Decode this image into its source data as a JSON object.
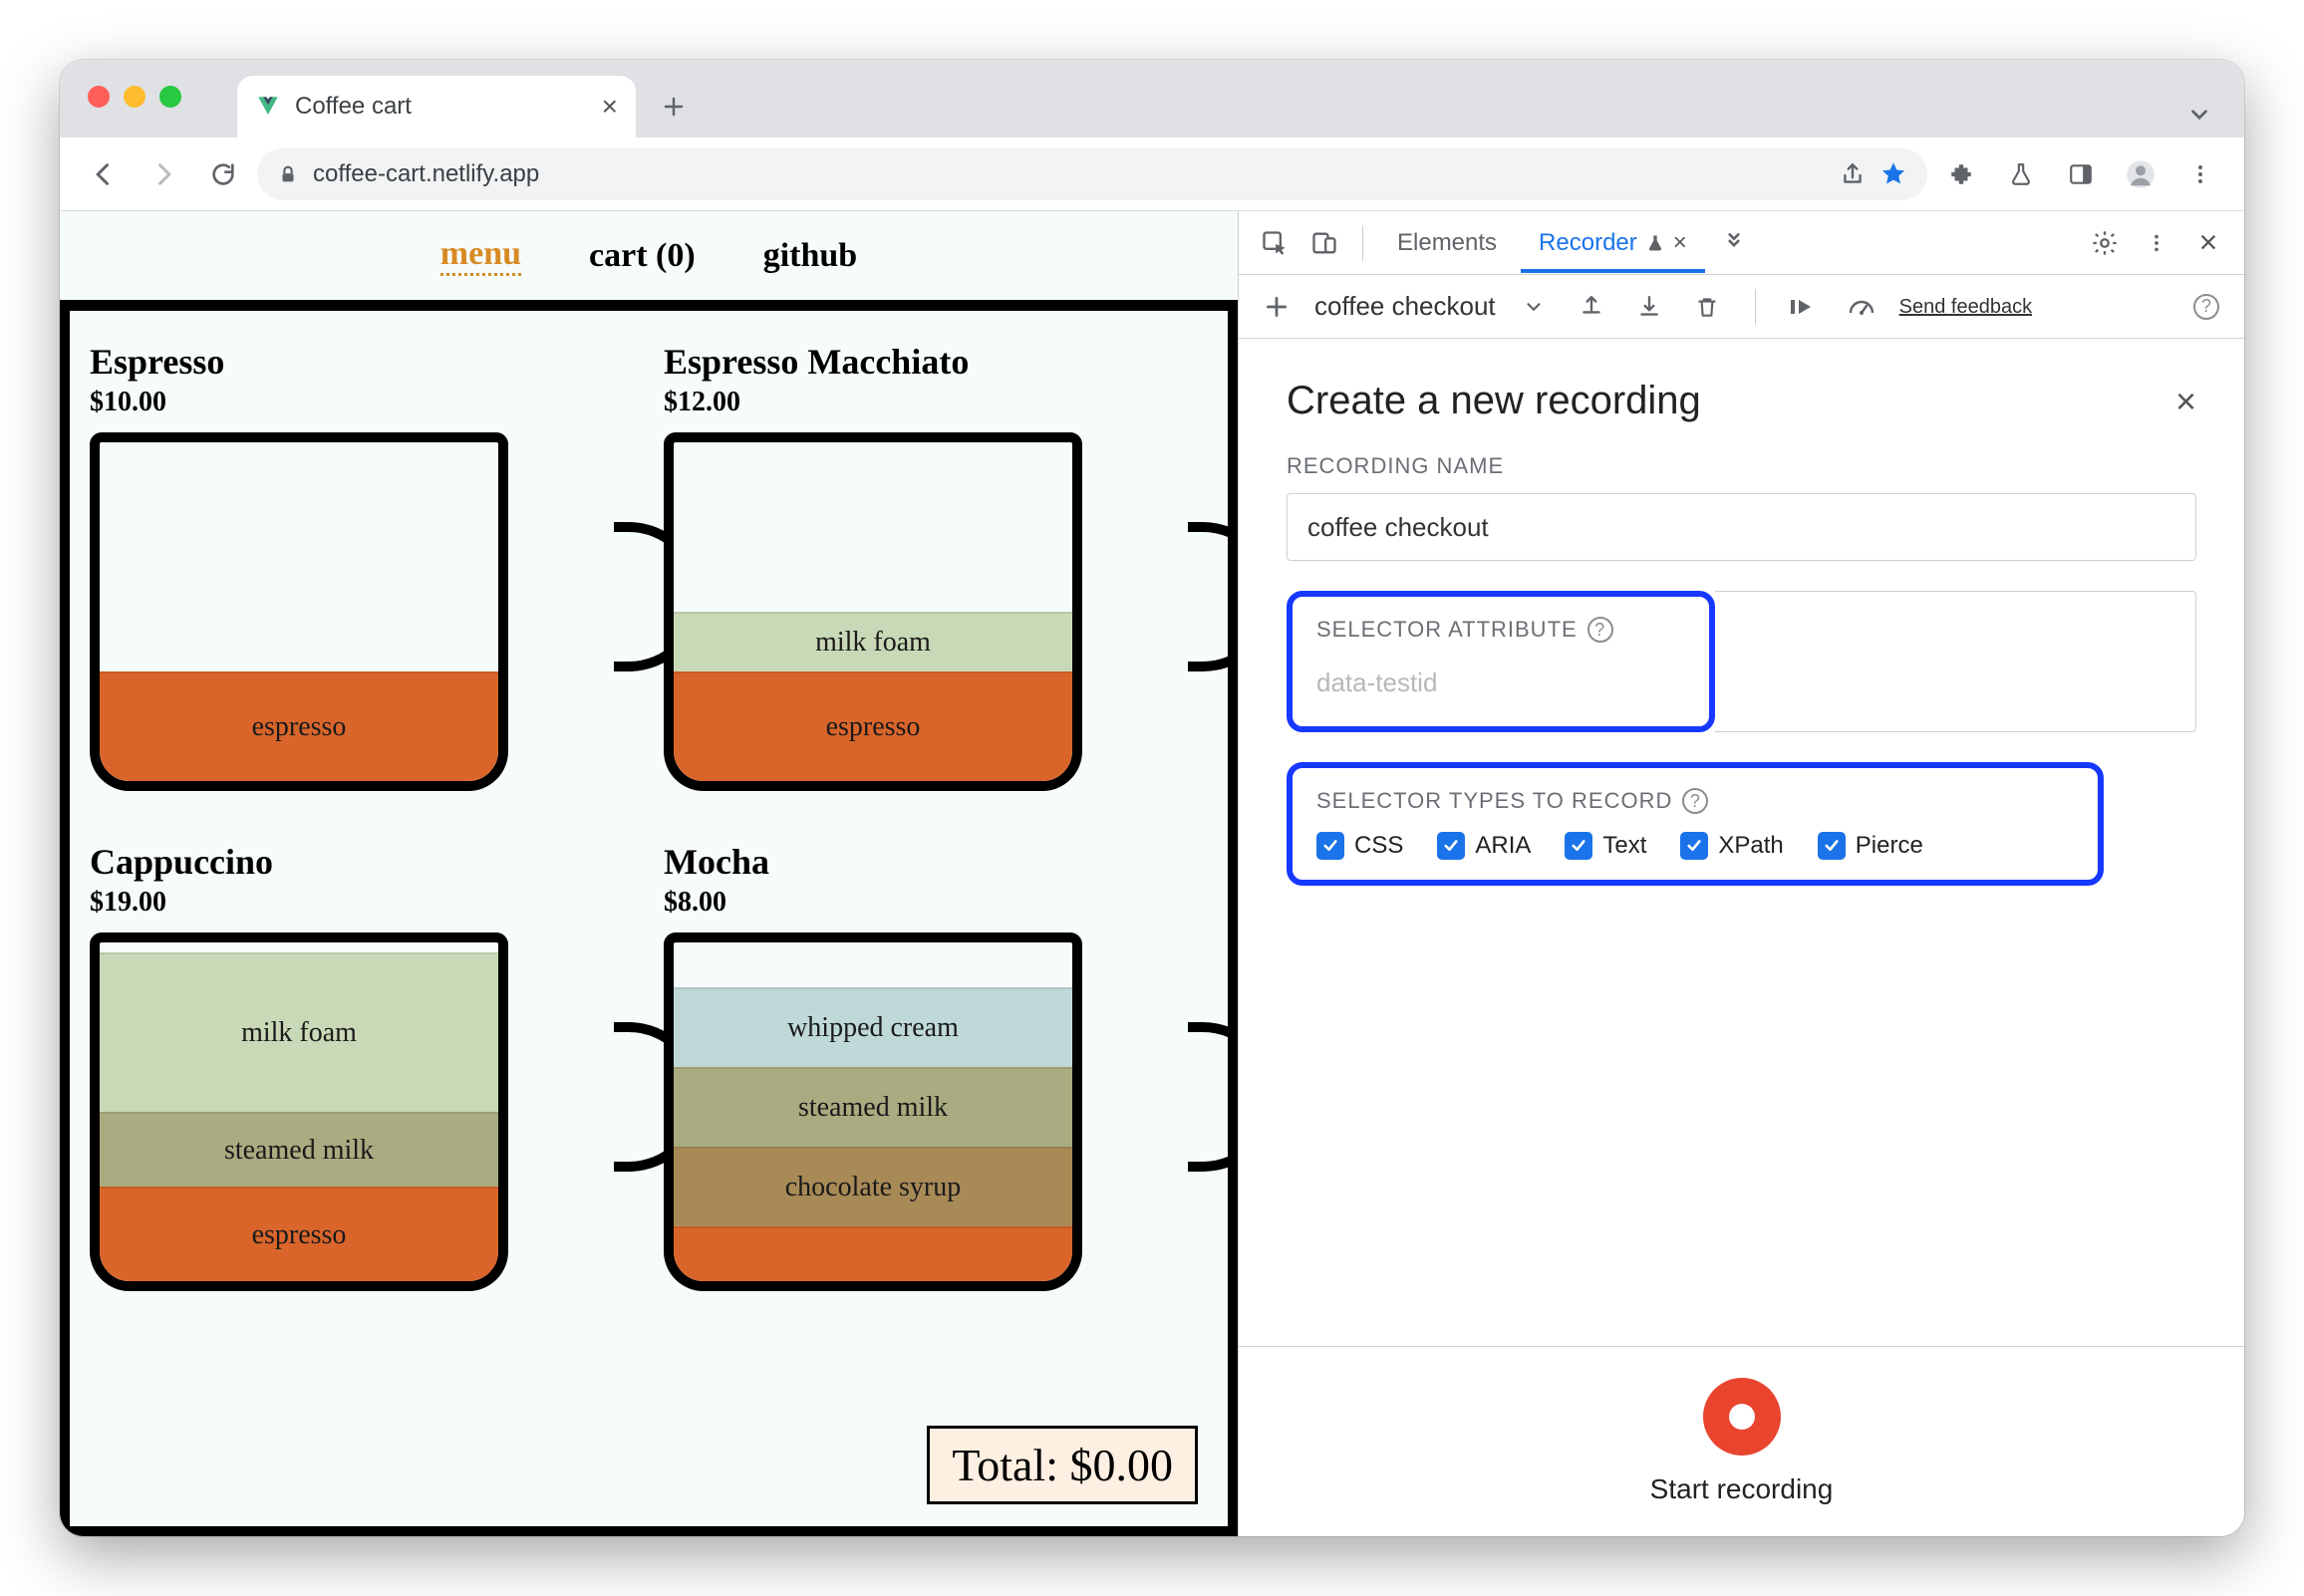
{
  "browser": {
    "tab_title": "Coffee cart",
    "url": "coffee-cart.netlify.app",
    "new_tab_tooltip": "+",
    "toolbar_icons": [
      "back",
      "forward",
      "reload",
      "share",
      "star",
      "extensions",
      "labs",
      "sidepanel",
      "profile",
      "menu",
      "dropdown"
    ]
  },
  "page": {
    "nav": {
      "menu": "menu",
      "cart": "cart (0)",
      "github": "github"
    },
    "drinks": [
      {
        "name": "Espresso",
        "price": "$10.00",
        "layers": [
          {
            "label": "espresso",
            "cls": "espresso",
            "h": 110
          }
        ]
      },
      {
        "name": "Espresso Macchiato",
        "price": "$12.00",
        "layers": [
          {
            "label": "milk foam",
            "cls": "milkfoam",
            "h": 60
          },
          {
            "label": "espresso",
            "cls": "espresso",
            "h": 110
          }
        ]
      },
      {
        "name": "Cappuccino",
        "price": "$19.00",
        "layers": [
          {
            "label": "milk foam",
            "cls": "milkfoam",
            "h": 160
          },
          {
            "label": "steamed milk",
            "cls": "steamedmilk",
            "h": 75
          },
          {
            "label": "espresso",
            "cls": "espresso",
            "h": 95
          }
        ]
      },
      {
        "name": "Mocha",
        "price": "$8.00",
        "layers": [
          {
            "label": "whipped cream",
            "cls": "whipped",
            "h": 80
          },
          {
            "label": "steamed milk",
            "cls": "steamedmilk",
            "h": 80
          },
          {
            "label": "chocolate syrup",
            "cls": "chocsyrup",
            "h": 80
          },
          {
            "label": "",
            "cls": "espresso",
            "h": 55
          }
        ]
      }
    ],
    "total_label": "Total: $0.00"
  },
  "devtools": {
    "tabs": {
      "elements": "Elements",
      "recorder": "Recorder"
    },
    "recording_dropdown": "coffee checkout",
    "send_feedback": "Send feedback",
    "panel": {
      "title": "Create a new recording",
      "recording_name_label": "RECORDING NAME",
      "recording_name_value": "coffee checkout",
      "selector_attr_label": "SELECTOR ATTRIBUTE",
      "selector_attr_placeholder": "data-testid",
      "selector_types_label": "SELECTOR TYPES TO RECORD",
      "selector_types": [
        {
          "id": "css",
          "label": "CSS",
          "checked": true
        },
        {
          "id": "aria",
          "label": "ARIA",
          "checked": true
        },
        {
          "id": "text",
          "label": "Text",
          "checked": true
        },
        {
          "id": "xpath",
          "label": "XPath",
          "checked": true
        },
        {
          "id": "pierce",
          "label": "Pierce",
          "checked": true
        }
      ],
      "start_label": "Start recording"
    }
  }
}
